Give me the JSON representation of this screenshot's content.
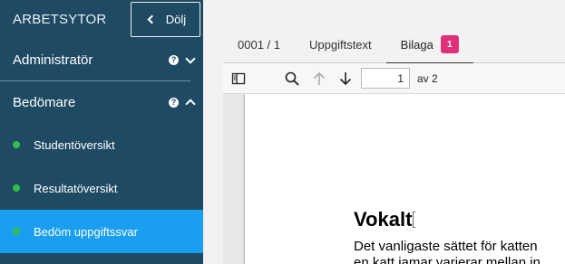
{
  "sidebar": {
    "title": "ARBETSYTOR",
    "hide_label": "Dölj",
    "sections": [
      {
        "label": "Administratör",
        "expanded": false
      },
      {
        "label": "Bedömare",
        "expanded": true
      }
    ],
    "items": [
      {
        "label": "Studentöversikt",
        "active": false
      },
      {
        "label": "Resultatöversikt",
        "active": false
      },
      {
        "label": "Bedöm uppgiftssvar",
        "active": true
      }
    ],
    "colors": {
      "background": "#1f4a63",
      "active": "#1a9ef0",
      "status_dot": "#2fbf4a"
    }
  },
  "tabs": [
    {
      "label": "0001 / 1",
      "active": false
    },
    {
      "label": "Uppgiftstext",
      "active": false
    },
    {
      "label": "Bilaga",
      "active": true,
      "badge": "1"
    }
  ],
  "toolbar": {
    "page_value": "1",
    "page_of": "av 2",
    "icons": [
      "sidebar-toggle-icon",
      "search-icon",
      "arrow-up-icon",
      "arrow-down-icon"
    ]
  },
  "document": {
    "title": "Vokalt",
    "lines": [
      "Det vanligaste sättet för katten",
      "en katt jamar varierar mellan in"
    ]
  },
  "accent": {
    "badge": "#e0307a"
  }
}
